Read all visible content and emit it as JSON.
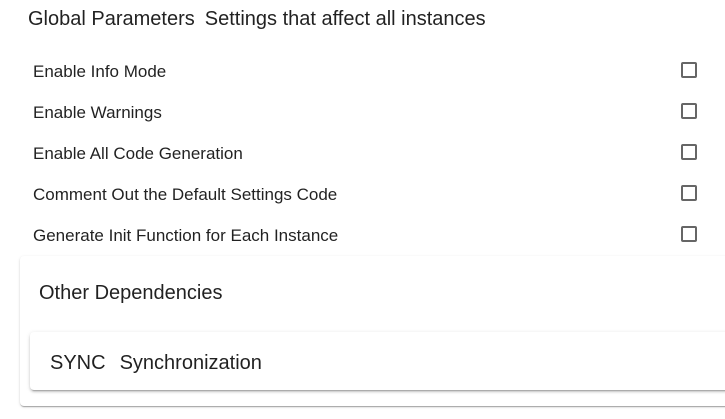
{
  "header": {
    "title": "Global Parameters",
    "subtitle": "Settings that affect all instances"
  },
  "parameters": [
    {
      "label": "Enable Info Mode",
      "checked": false
    },
    {
      "label": "Enable Warnings",
      "checked": false
    },
    {
      "label": "Enable All Code Generation",
      "checked": false
    },
    {
      "label": "Comment Out the Default Settings Code",
      "checked": false
    },
    {
      "label": "Generate Init Function for Each Instance",
      "checked": false
    }
  ],
  "dependencies": {
    "title": "Other Dependencies",
    "items": [
      {
        "name": "SYNC",
        "description": "Synchronization"
      }
    ]
  }
}
